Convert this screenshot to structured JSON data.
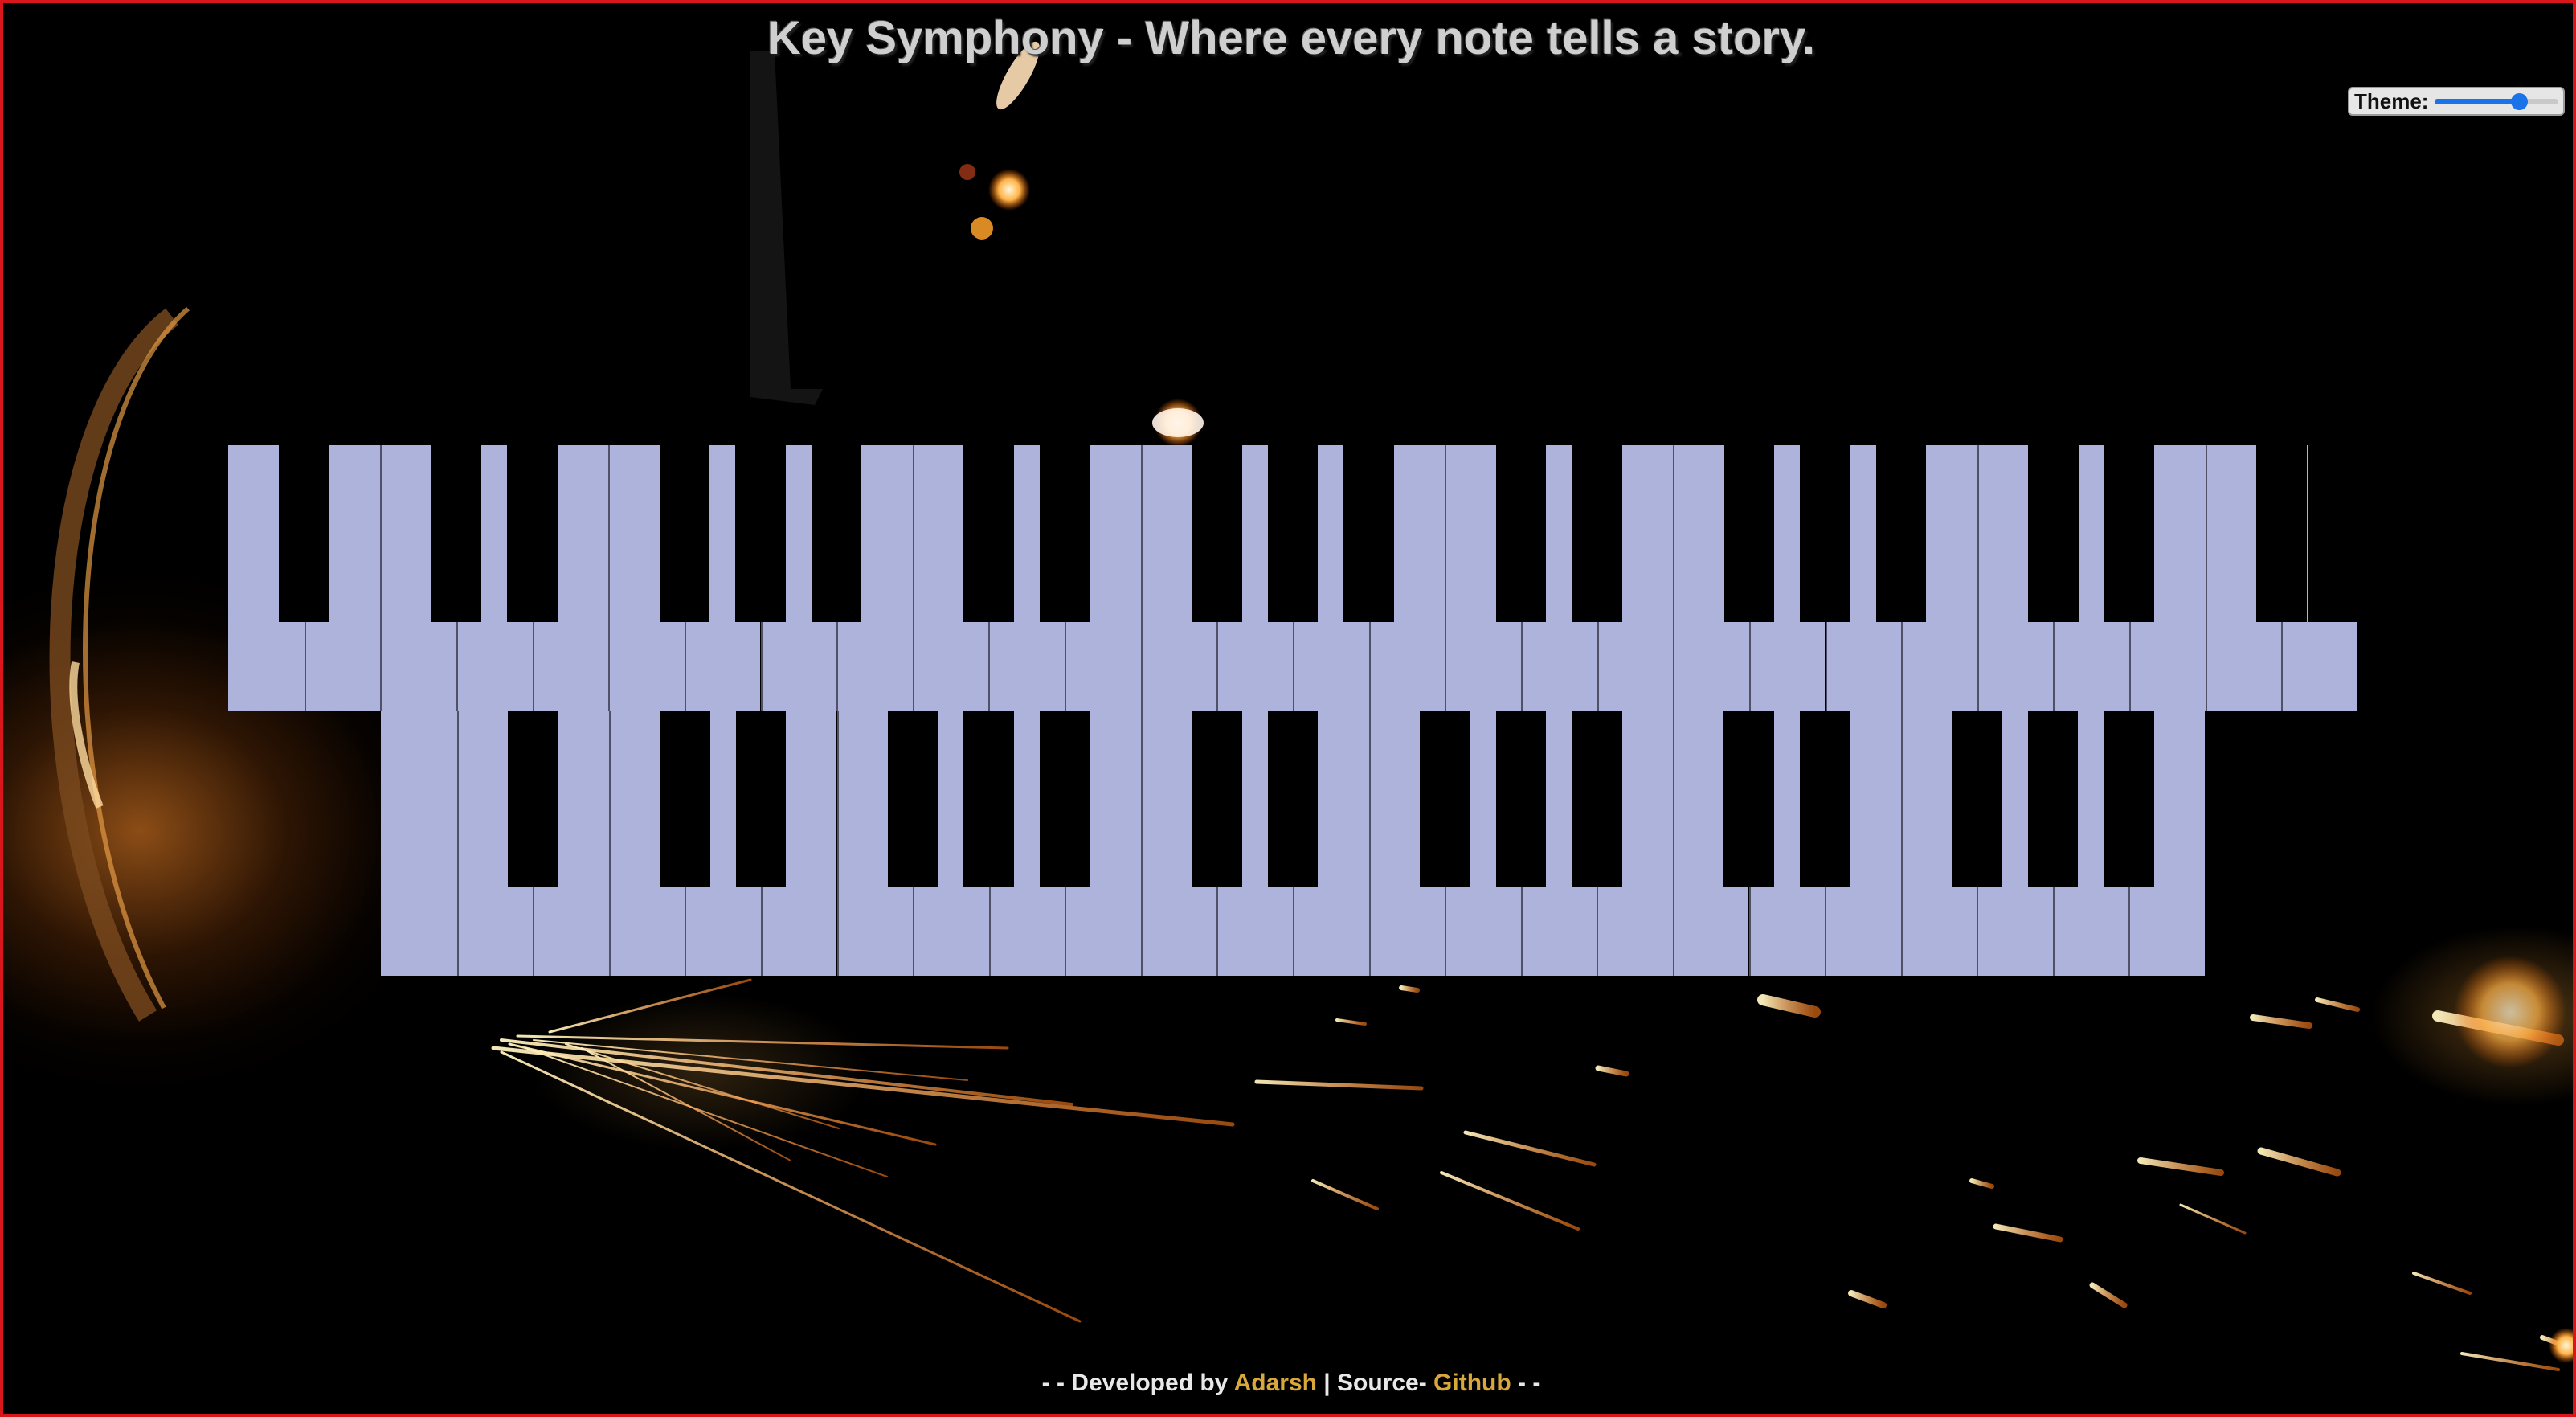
{
  "header": {
    "title": "Key Symphony - Where every note tells a story."
  },
  "theme_control": {
    "label": "Theme:",
    "value": 0.68,
    "accent_color": "#1a73e8"
  },
  "keyboards": [
    {
      "name": "upper",
      "white_keys": 28,
      "black_key_pattern": [
        1,
        0,
        1,
        1,
        0,
        1,
        1,
        1,
        0,
        1,
        1,
        0,
        1,
        1,
        1,
        0,
        1,
        1,
        0,
        1,
        1,
        1,
        0,
        1,
        1,
        0,
        1,
        1
      ]
    },
    {
      "name": "lower",
      "white_keys": 24,
      "black_key_pattern": [
        0,
        1,
        0,
        1,
        1,
        0,
        1,
        1,
        1,
        0,
        1,
        1,
        0,
        1,
        1,
        1,
        0,
        1,
        1,
        0,
        1,
        1,
        1,
        0
      ]
    }
  ],
  "key_colors": {
    "white": "#adb3db",
    "black": "#000000",
    "divider": "#4f5266"
  },
  "footer": {
    "prefix": "- - Developed by ",
    "author": "Adarsh",
    "separator": " | Source- ",
    "source": "Github",
    "suffix": " - -",
    "link_color": "#d8a93a"
  },
  "frame_color": "#d8161b"
}
